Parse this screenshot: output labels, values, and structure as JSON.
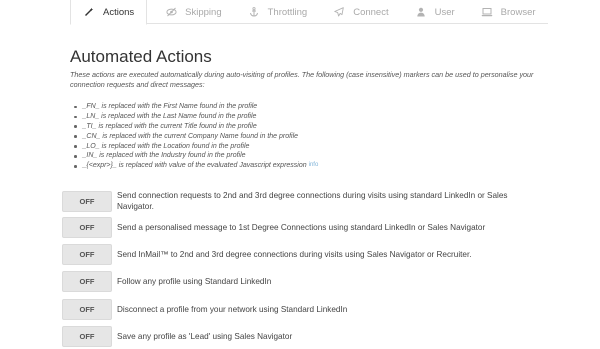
{
  "tabs": [
    {
      "label": "Actions",
      "icon": "wand-icon",
      "active": true
    },
    {
      "label": "Skipping",
      "icon": "eye-slash-icon",
      "active": false
    },
    {
      "label": "Throttling",
      "icon": "anchor-icon",
      "active": false
    },
    {
      "label": "Connect",
      "icon": "paper-plane-icon",
      "active": false
    },
    {
      "label": "User",
      "icon": "user-icon",
      "active": false
    },
    {
      "label": "Browser",
      "icon": "laptop-icon",
      "active": false
    }
  ],
  "heading": "Automated Actions",
  "intro": "These actions are executed automatically during auto-visiting of profiles. The following (case insensitive) markers can be used to personalise your connection requests and direct messages:",
  "markers": [
    "_FN_ is replaced with the First Name found in the profile",
    "_LN_ is replaced with the Last Name found in the profile",
    "_TI_ is replaced with the current Title found in the profile",
    "_CN_ is replaced with the current Company Name found in the profile",
    "_LO_ is replaced with the Location found in the profile",
    "_IN_ is replaced with the Industry found in the profile",
    "_{<expr>}_ is replaced with value of the evaluated Javascript expression"
  ],
  "marker_info": "info",
  "actions": [
    {
      "state": "OFF",
      "text": "Send connection requests to 2nd and 3rd degree connections during visits using standard LinkedIn or Sales Navigator."
    },
    {
      "state": "OFF",
      "text": "Send a personalised message to 1st Degree Connections using standard LinkedIn or Sales Navigator"
    },
    {
      "state": "OFF",
      "text": "Send InMail™ to 2nd and 3rd degree connections during visits using Sales Navigator or Recruiter."
    },
    {
      "state": "OFF",
      "text": "Follow any profile using Standard LinkedIn"
    },
    {
      "state": "OFF",
      "text": "Disconnect a profile from your network using Standard LinkedIn"
    },
    {
      "state": "OFF",
      "text": "Save any profile as 'Lead' using Sales Navigator"
    }
  ]
}
